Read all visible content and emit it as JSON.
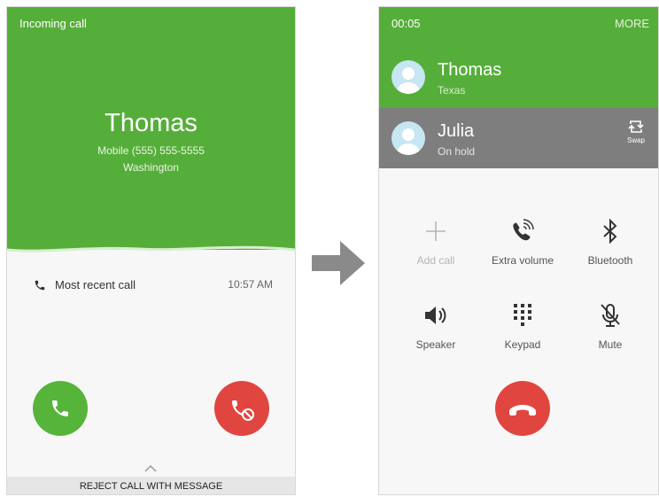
{
  "incoming": {
    "status_label": "Incoming call",
    "caller_name": "Thomas",
    "caller_number": "Mobile (555) 555-5555",
    "caller_location": "Washington",
    "recent_label": "Most recent call",
    "recent_time": "10:57 AM",
    "reject_message_label": "REJECT CALL WITH MESSAGE"
  },
  "active": {
    "timer": "00:05",
    "more_label": "MORE",
    "contacts": [
      {
        "name": "Thomas",
        "sub": "Texas"
      },
      {
        "name": "Julia",
        "sub": "On hold"
      }
    ],
    "swap_label": "Swap",
    "controls": [
      {
        "label": "Add call",
        "icon": "plus-icon",
        "enabled": false
      },
      {
        "label": "Extra volume",
        "icon": "extra-volume-icon",
        "enabled": true
      },
      {
        "label": "Bluetooth",
        "icon": "bluetooth-icon",
        "enabled": true
      },
      {
        "label": "Speaker",
        "icon": "speaker-icon",
        "enabled": true
      },
      {
        "label": "Keypad",
        "icon": "keypad-icon",
        "enabled": true
      },
      {
        "label": "Mute",
        "icon": "mute-icon",
        "enabled": true
      }
    ]
  },
  "colors": {
    "green": "#56ae3a",
    "red": "#e0463f",
    "hold_gray": "#7e7e7e",
    "arrow_gray": "#8a8a8a"
  }
}
